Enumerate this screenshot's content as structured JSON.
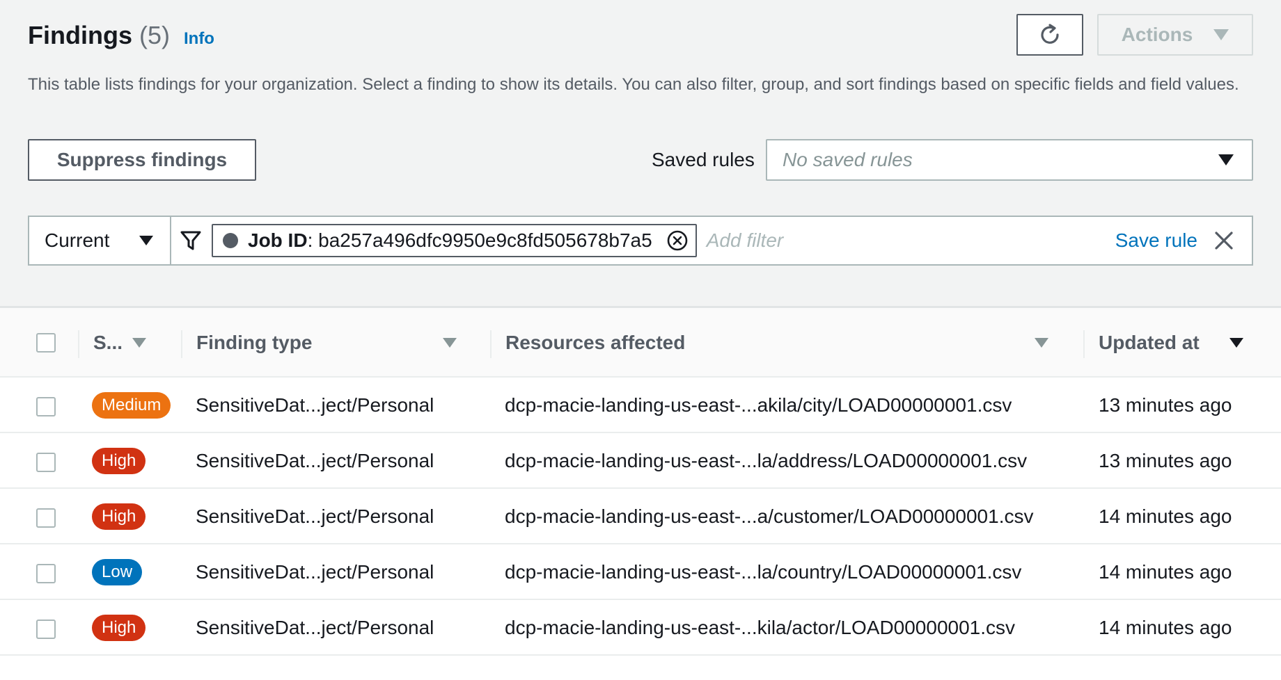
{
  "header": {
    "title": "Findings",
    "count": "(5)",
    "info_link": "Info",
    "actions_label": "Actions",
    "description": "This table lists findings for your organization. Select a finding to show its details. You can also filter, group, and sort findings based on specific fields and field values."
  },
  "toolbar": {
    "suppress_label": "Suppress findings",
    "saved_rules_label": "Saved rules",
    "saved_rules_placeholder": "No saved rules"
  },
  "filter": {
    "scope": "Current",
    "token_key": "Job ID",
    "token_sep": ":",
    "token_value": " ba257a496dfc9950e9c8fd505678b7a5",
    "add_placeholder": "Add filter",
    "save_rule": "Save rule"
  },
  "table": {
    "columns": {
      "severity": "S...",
      "finding_type": "Finding type",
      "resources": "Resources affected",
      "updated": "Updated at"
    },
    "rows": [
      {
        "severity": "Medium",
        "severity_color": "#ec7211",
        "finding_type": "SensitiveDat...ject/Personal",
        "resource": "dcp-macie-landing-us-east-...akila/city/LOAD00000001.csv",
        "updated": "13 minutes ago"
      },
      {
        "severity": "High",
        "severity_color": "#d13212",
        "finding_type": "SensitiveDat...ject/Personal",
        "resource": "dcp-macie-landing-us-east-...la/address/LOAD00000001.csv",
        "updated": "13 minutes ago"
      },
      {
        "severity": "High",
        "severity_color": "#d13212",
        "finding_type": "SensitiveDat...ject/Personal",
        "resource": "dcp-macie-landing-us-east-...a/customer/LOAD00000001.csv",
        "updated": "14 minutes ago"
      },
      {
        "severity": "Low",
        "severity_color": "#0073bb",
        "finding_type": "SensitiveDat...ject/Personal",
        "resource": "dcp-macie-landing-us-east-...la/country/LOAD00000001.csv",
        "updated": "14 minutes ago"
      },
      {
        "severity": "High",
        "severity_color": "#d13212",
        "finding_type": "SensitiveDat...ject/Personal",
        "resource": "dcp-macie-landing-us-east-...kila/actor/LOAD00000001.csv",
        "updated": "14 minutes ago"
      }
    ]
  },
  "icons": {
    "refresh": "refresh-icon",
    "actions_caret": "caret-down-icon",
    "funnel": "filter-funnel-icon",
    "token_remove": "remove-circle-icon",
    "clear": "close-icon"
  }
}
